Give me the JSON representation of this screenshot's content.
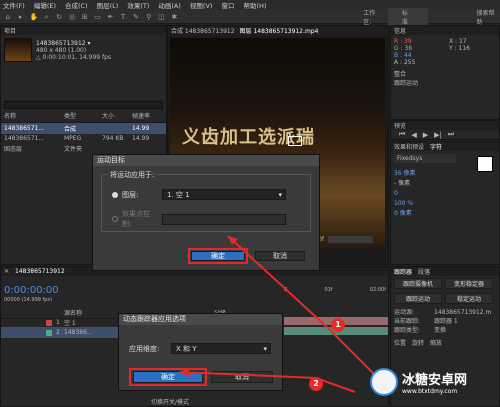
{
  "menu": [
    "文件(F)",
    "编辑(E)",
    "合成(C)",
    "图层(L)",
    "效果(T)",
    "动画(A)",
    "视图(V)",
    "窗口",
    "帮助(H)"
  ],
  "toolbar": {
    "workspace_label": "工作区:",
    "workspace_value": "标准",
    "search_label": "搜索帮助"
  },
  "project": {
    "tab": "项目",
    "comp_name": "1483865713912 ▾",
    "comp_info1": "480 x 480 (1.00)",
    "comp_info2": "△ 0:00:10:01, 14.999 fps",
    "col_name": "名称",
    "col_type": "类型",
    "col_size": "大小",
    "col_rate": "帧速率",
    "rows": [
      {
        "name": "148386571...",
        "type": "合成",
        "size": "",
        "rate": "14.99"
      },
      {
        "name": "148386571...",
        "type": "MPEG",
        "size": "794 KB",
        "rate": "14.99"
      },
      {
        "name": "固态层",
        "type": "文件夹",
        "size": "",
        "rate": ""
      }
    ]
  },
  "viewer": {
    "tab_effects": "效果控件 1483865713912.mp4",
    "tab_comp": "合成 1483865713912",
    "tab_layer": "图层 1483865713912.mp4",
    "video_text": "义齿加工选派瑞",
    "zoom": "0f"
  },
  "info": {
    "tab": "信息",
    "r": "R : 39",
    "g": "G : 38",
    "b": "B : 44",
    "a": "A : 255",
    "x": "X : 17",
    "y": "Y : 116",
    "line1": "整合",
    "line2": "跟踪运动"
  },
  "right_tabs": {
    "preview": "预览",
    "effects": "效果和预设",
    "char": "字符",
    "font": "Fixedsys",
    "size": "36 像素",
    "leading": "- 像素",
    "tracking": "0",
    "scale_v": "100 %",
    "scale_h": "100 %",
    "baseline": "0 像素",
    "tsume": "0 %"
  },
  "tracker": {
    "tab1": "跟踪器",
    "tab2": "段落",
    "btn_camera": "跟踪摄像机",
    "btn_warp": "变形稳定器",
    "btn_track": "跟踪运动",
    "btn_stabilize": "稳定运动",
    "source_label": "运动源:",
    "source_value": "1483865713912.m",
    "current_label": "当前跟踪:",
    "current_value": "跟踪器 1",
    "type_label": "跟踪类型:",
    "type_value": "变换",
    "pos_label": "位置",
    "rot_label": "旋转",
    "scale_label": "缩放"
  },
  "timeline": {
    "tab": "1483865713912",
    "timecode": "0:00:00:00",
    "fps": "00000 (14.999 fps)",
    "col_name": "源名称",
    "col_parent": "父级",
    "layers": [
      {
        "num": "1",
        "name": "空 1",
        "parent": "无"
      },
      {
        "num": "2",
        "name": "148386...",
        "parent": "无"
      }
    ],
    "ruler": [
      "0",
      "01f",
      "02:00f"
    ],
    "footer": "切换开关/模式"
  },
  "dialog1": {
    "title": "运动目标",
    "apply_label": "将运动应用于:",
    "layer_label": "图层:",
    "layer_value": "1. 空 1",
    "effect_label": "效果点控制:",
    "ok": "确定",
    "cancel": "取消"
  },
  "dialog2": {
    "title": "动态跟踪器应用选项",
    "dim_label": "应用维度:",
    "dim_value": "X 和 Y",
    "ok": "确定",
    "cancel": "取消"
  },
  "badges": [
    "1",
    "2"
  ],
  "watermark": {
    "brand": "冰糖安卓网",
    "url": "www.btxtdmy.com"
  },
  "colors": {
    "accent": "#2b6fc2",
    "highlight": "#e0292d",
    "bg": "#232323"
  }
}
